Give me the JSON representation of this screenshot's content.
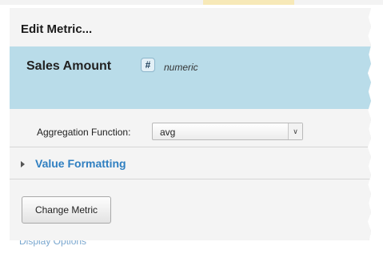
{
  "dialog": {
    "title": "Edit Metric..."
  },
  "metric": {
    "name": "Sales Amount",
    "type_icon": "#",
    "type_label": "numeric"
  },
  "aggregation": {
    "label": "Aggregation Function:",
    "selected": "avg"
  },
  "value_formatting": {
    "label": "Value Formatting",
    "expanded": false
  },
  "actions": {
    "change_metric_label": "Change Metric"
  },
  "background": {
    "partial_link_text": "Display Options"
  },
  "colors": {
    "metric_band": "#b9dce9",
    "section_link": "#2f7fc1",
    "dialog_bg": "#f4f4f4"
  },
  "icons": {
    "type_icon": "hash-icon",
    "select_arrow": "double-chevron-icon",
    "section_toggle": "triangle-right-icon"
  }
}
